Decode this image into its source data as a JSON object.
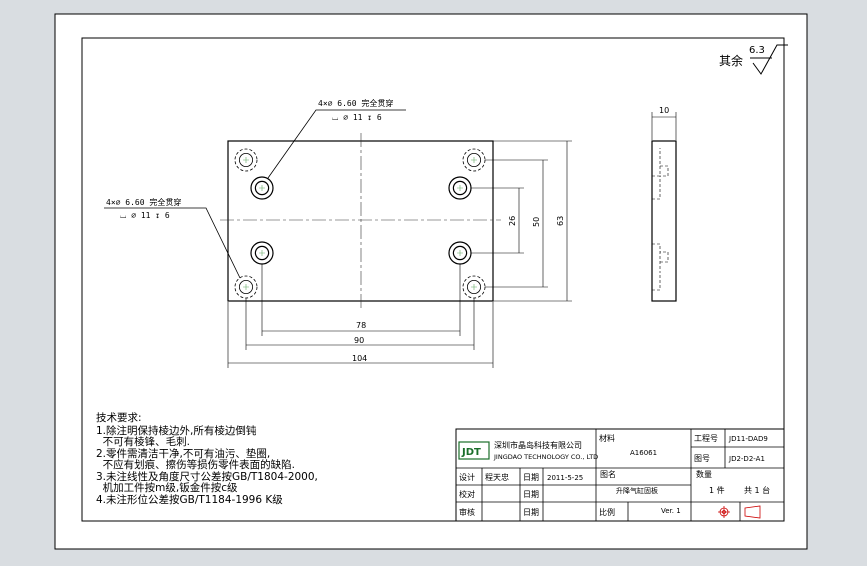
{
  "drawing": {
    "roughness": {
      "prefix": "其余",
      "value": "6.3"
    },
    "hole_callout_top": {
      "line1": "4×⌀ 6.60 完全贯穿",
      "line2": "⌴ ⌀ 11 ↧ 6"
    },
    "hole_callout_left": {
      "line1": "4×⌀ 6.60 完全贯穿",
      "line2": "⌴ ⌀ 11 ↧ 6"
    },
    "dims": {
      "d78": "78",
      "d90": "90",
      "d104": "104",
      "d26": "26",
      "d50": "50",
      "d63": "63",
      "d10": "10"
    }
  },
  "notes": {
    "title": "技术要求:",
    "lines": [
      "1.除注明保持棱边外,所有棱边倒钝",
      "  不可有棱锋、毛刺.",
      "2.零件需清洁干净,不可有油污、垫圈,",
      "  不应有划痕、擦伤等损伤零件表面的缺陷.",
      "3.未注线性及角度尺寸公差按GB/T1804-2000,",
      "  机加工件按m级,钣金件按c级",
      "4.未注形位公差按GB/T1184-1996 K级"
    ]
  },
  "title_block": {
    "logo_text": "JDT",
    "company_cn": "深圳市晶岛科技有限公司",
    "company_en": "JINGDAO TECHNOLOGY CO., LTD",
    "material_label": "材料",
    "material_value": "A16061",
    "drawing_no_label": "工程号",
    "drawing_no_value": "JD11-DAD9",
    "figure_no_label": "图号",
    "figure_no_value": "JD2-D2-A1",
    "design_label": "设计",
    "design_value": "程天忠",
    "date_label": "日期",
    "date_value": "2011-5-25",
    "part_name_label": "图名",
    "part_name_value": "升降气缸固板",
    "qty_label": "数量",
    "qty_piece": "1 件",
    "qty_total": "共 1 台",
    "check_label": "校对",
    "check_date_label": "日期",
    "approve_label": "审核",
    "approve_date_label": "日期",
    "scale_label": "比例",
    "version": "Ver. 1"
  }
}
